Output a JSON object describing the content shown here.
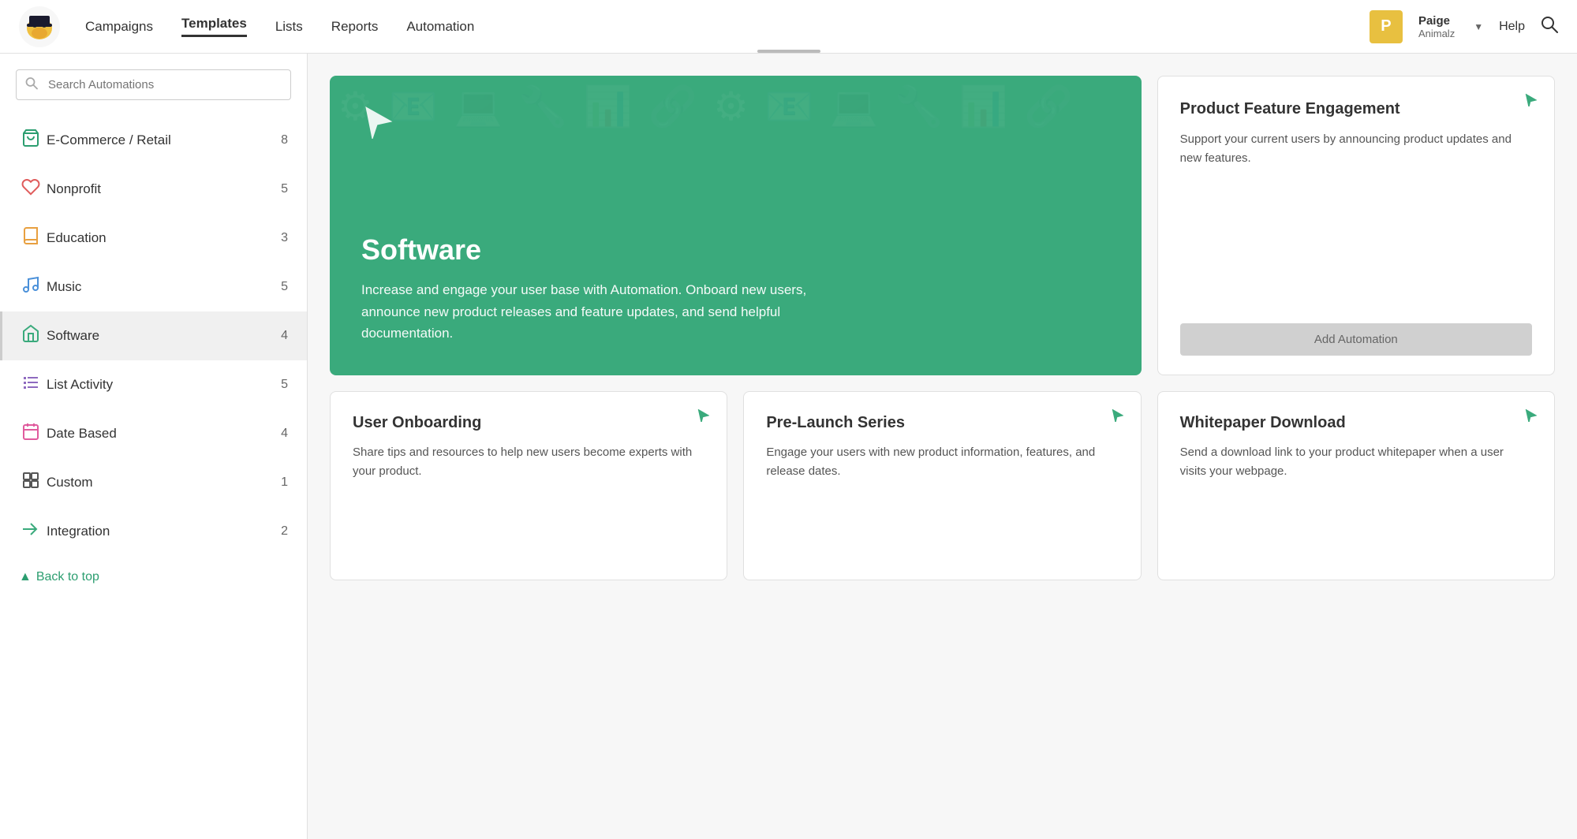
{
  "header": {
    "logo_alt": "Mailchimp",
    "nav": [
      {
        "label": "Campaigns",
        "active": false
      },
      {
        "label": "Templates",
        "active": true
      },
      {
        "label": "Lists",
        "active": false
      },
      {
        "label": "Reports",
        "active": false
      },
      {
        "label": "Automation",
        "active": false
      }
    ],
    "user": {
      "initial": "P",
      "name": "Paige",
      "org": "Animalz"
    },
    "help": "Help"
  },
  "sidebar": {
    "search_placeholder": "Search Automations",
    "items": [
      {
        "id": "ecommerce",
        "label": "E-Commerce / Retail",
        "count": 8,
        "icon": "🛒",
        "color": "icon-green",
        "active": false
      },
      {
        "id": "nonprofit",
        "label": "Nonprofit",
        "count": 5,
        "icon": "♥",
        "color": "icon-red",
        "active": false
      },
      {
        "id": "education",
        "label": "Education",
        "count": 3,
        "icon": "📖",
        "color": "icon-orange",
        "active": false
      },
      {
        "id": "music",
        "label": "Music",
        "count": 5,
        "icon": "🎵",
        "color": "icon-blue",
        "active": false
      },
      {
        "id": "software",
        "label": "Software",
        "count": 4,
        "icon": "↖",
        "color": "icon-teal",
        "active": true
      },
      {
        "id": "list-activity",
        "label": "List Activity",
        "count": 5,
        "icon": "☰",
        "color": "icon-purple",
        "active": false
      },
      {
        "id": "date-based",
        "label": "Date Based",
        "count": 4,
        "icon": "📅",
        "color": "icon-pink",
        "active": false
      },
      {
        "id": "custom",
        "label": "Custom",
        "count": 1,
        "icon": "⊞",
        "color": "icon-gray",
        "active": false
      },
      {
        "id": "integration",
        "label": "Integration",
        "count": 2,
        "icon": "→→",
        "color": "icon-teal",
        "active": false
      }
    ],
    "back_to_top": "Back to top"
  },
  "hero": {
    "title": "Software",
    "description": "Increase and engage your user base with Automation. Onboard new users, announce new product releases and feature updates, and send helpful documentation."
  },
  "cards": [
    {
      "id": "product-feature",
      "title": "Product Feature Engagement",
      "description": "Support your current users by announcing product updates and new features.",
      "button_label": "Add Automation"
    },
    {
      "id": "user-onboarding",
      "title": "User Onboarding",
      "description": "Share tips and resources to help new users become experts with your product."
    },
    {
      "id": "pre-launch",
      "title": "Pre-Launch Series",
      "description": "Engage your users with new product information, features, and release dates."
    },
    {
      "id": "whitepaper",
      "title": "Whitepaper Download",
      "description": "Send a download link to your product whitepaper when a user visits your webpage."
    }
  ]
}
